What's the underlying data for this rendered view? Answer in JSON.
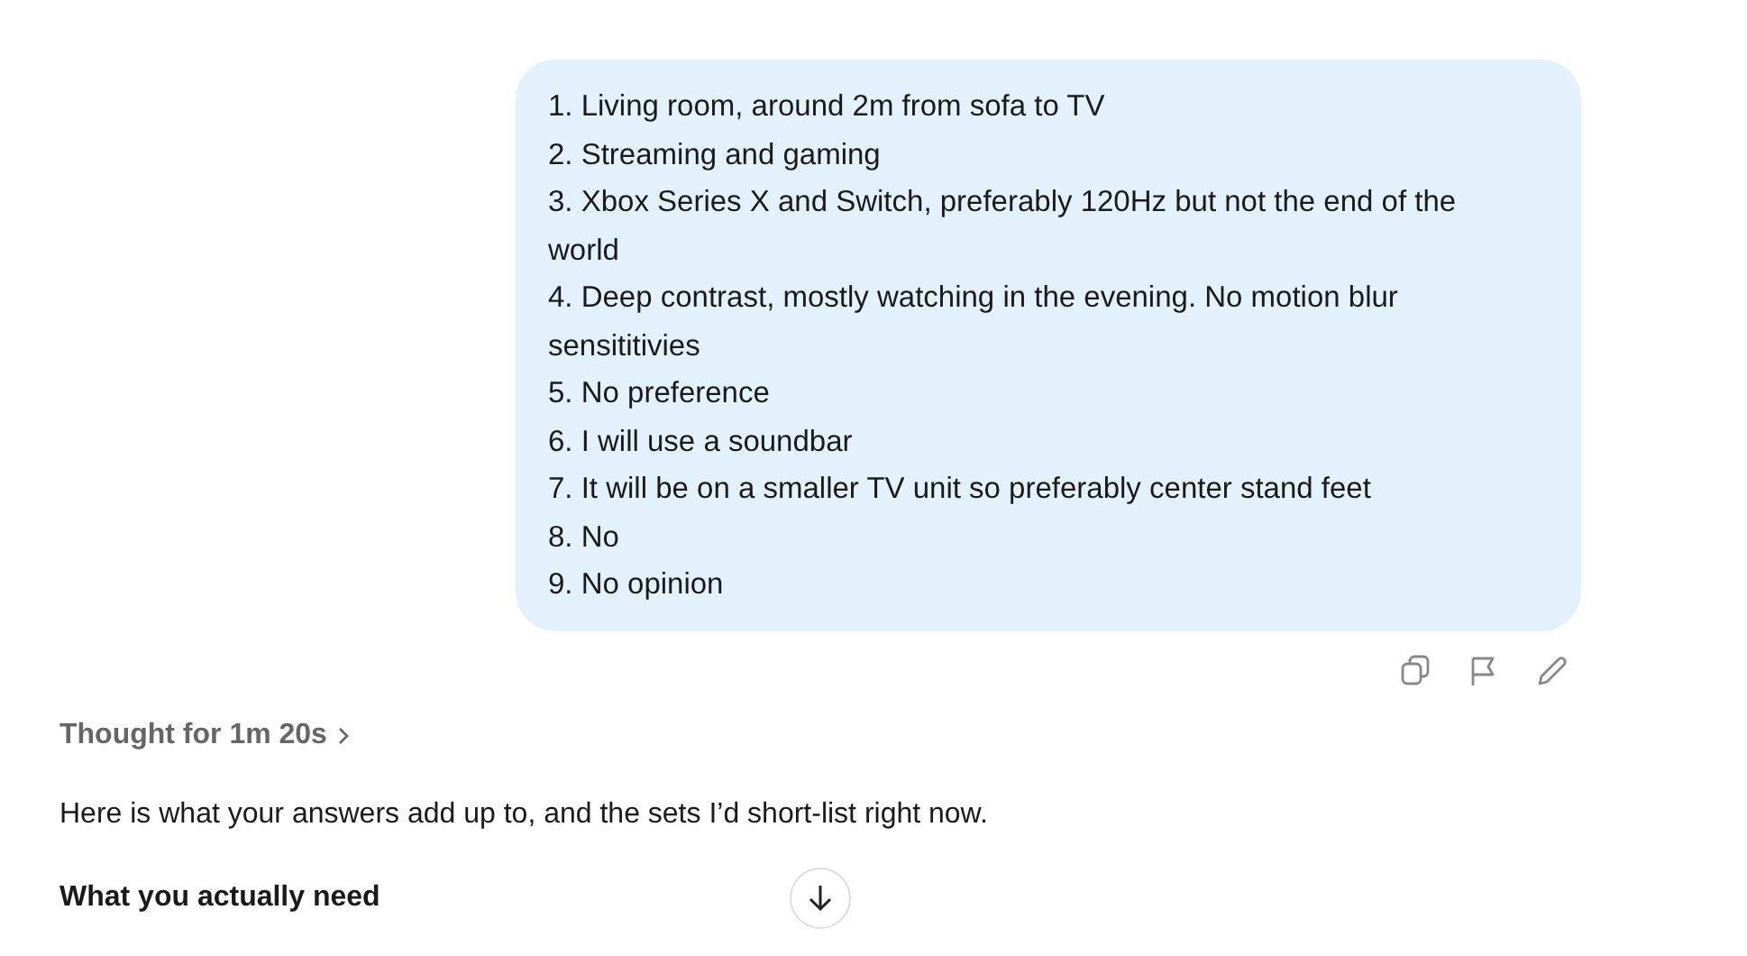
{
  "user_message": {
    "lines": [
      "1. Living room, around 2m from sofa to TV",
      "2. Streaming and gaming",
      "3. Xbox Series X and Switch, preferably 120Hz but not the end of the world",
      "4. Deep contrast, mostly watching in the evening. No motion blur sensititivies",
      "5. No preference",
      "6. I will use a soundbar",
      "7. It will be on a smaller TV unit so preferably center stand feet",
      "8. No",
      "9. No opinion"
    ]
  },
  "assistant": {
    "thought": "Thought for 1m 20s",
    "intro": "Here is what your answers add up to, and the sets I’d short-list right now.",
    "heading": "What you actually need"
  }
}
